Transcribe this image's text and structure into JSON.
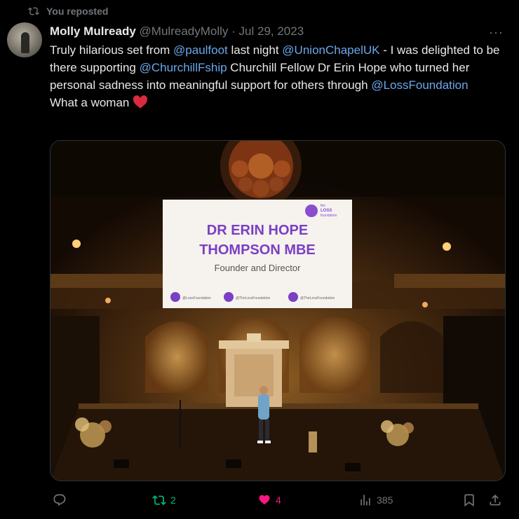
{
  "repost_banner": {
    "label": "You reposted",
    "icon": "repost-icon"
  },
  "author": {
    "name": "Molly Mulready",
    "handle": "@MulreadyMolly",
    "separator": "·",
    "date": "Jul 29, 2023"
  },
  "more_label": "···",
  "text": {
    "p1": "Truly hilarious set from ",
    "m1": "@paulfoot",
    "p2": " last night ",
    "m2": "@UnionChapelUK",
    "p3": " - I was delighted to be there supporting ",
    "m3": "@ChurchillFship",
    "p4": " Churchill Fellow Dr Erin Hope who turned her personal sadness into meaningful support for others through ",
    "m4": "@LossFoundation",
    "line2": "What a woman "
  },
  "media": {
    "screen_title_1": "DR ERIN HOPE",
    "screen_title_2": "THOMPSON MBE",
    "screen_subtitle": "Founder and Director",
    "logo_line1": "the",
    "logo_line2": "LOSS",
    "logo_line3": "foundation",
    "social_1": "@LossFoundation",
    "social_2": "@TheLossFoundation",
    "social_3": "@TheLossFoundation"
  },
  "actions": {
    "reply_count": "",
    "repost_count": "2",
    "like_count": "4",
    "views_count": "385"
  },
  "colors": {
    "mention": "#6aa8ea",
    "repost_active": "#00ba7c",
    "like_active": "#f91880",
    "muted": "#71767b"
  }
}
